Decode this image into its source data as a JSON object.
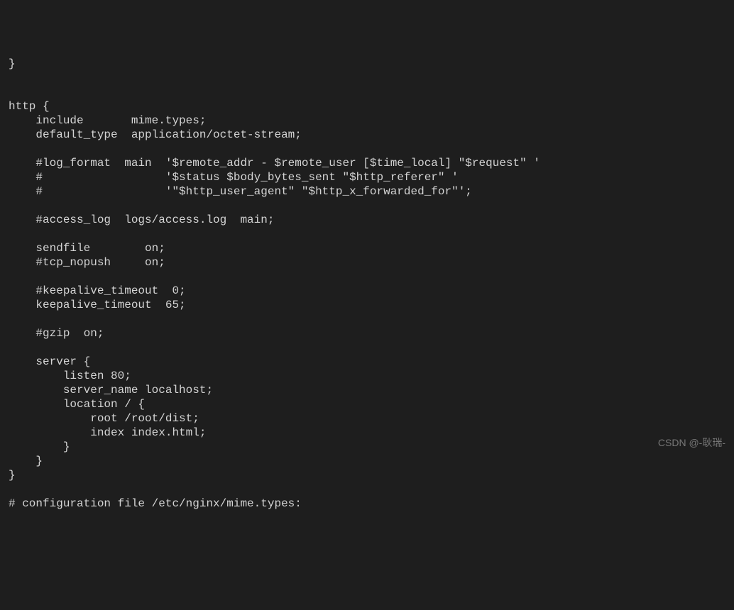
{
  "lines": {
    "l0": "}",
    "l1": "",
    "l2": "",
    "l3": "http {",
    "l4": "    include       mime.types;",
    "l5": "    default_type  application/octet-stream;",
    "l6": "",
    "l7": "    #log_format  main  '$remote_addr - $remote_user [$time_local] \"$request\" '",
    "l8": "    #                  '$status $body_bytes_sent \"$http_referer\" '",
    "l9": "    #                  '\"$http_user_agent\" \"$http_x_forwarded_for\"';",
    "l10": "",
    "l11": "    #access_log  logs/access.log  main;",
    "l12": "",
    "l13": "    sendfile        on;",
    "l14": "    #tcp_nopush     on;",
    "l15": "",
    "l16": "    #keepalive_timeout  0;",
    "l17": "    keepalive_timeout  65;",
    "l18": "",
    "l19": "    #gzip  on;",
    "l20": "",
    "l21": "    server {",
    "l22": "        listen 80;",
    "l23": "        server_name localhost;",
    "l24": "        location / {",
    "l25": "            root /root/dist;",
    "l26": "            index index.html;",
    "l27": "        }",
    "l28": "    }",
    "l29": "}",
    "l30": "",
    "l31": "# configuration file /etc/nginx/mime.types:"
  },
  "watermark": "CSDN @-耿瑞-"
}
